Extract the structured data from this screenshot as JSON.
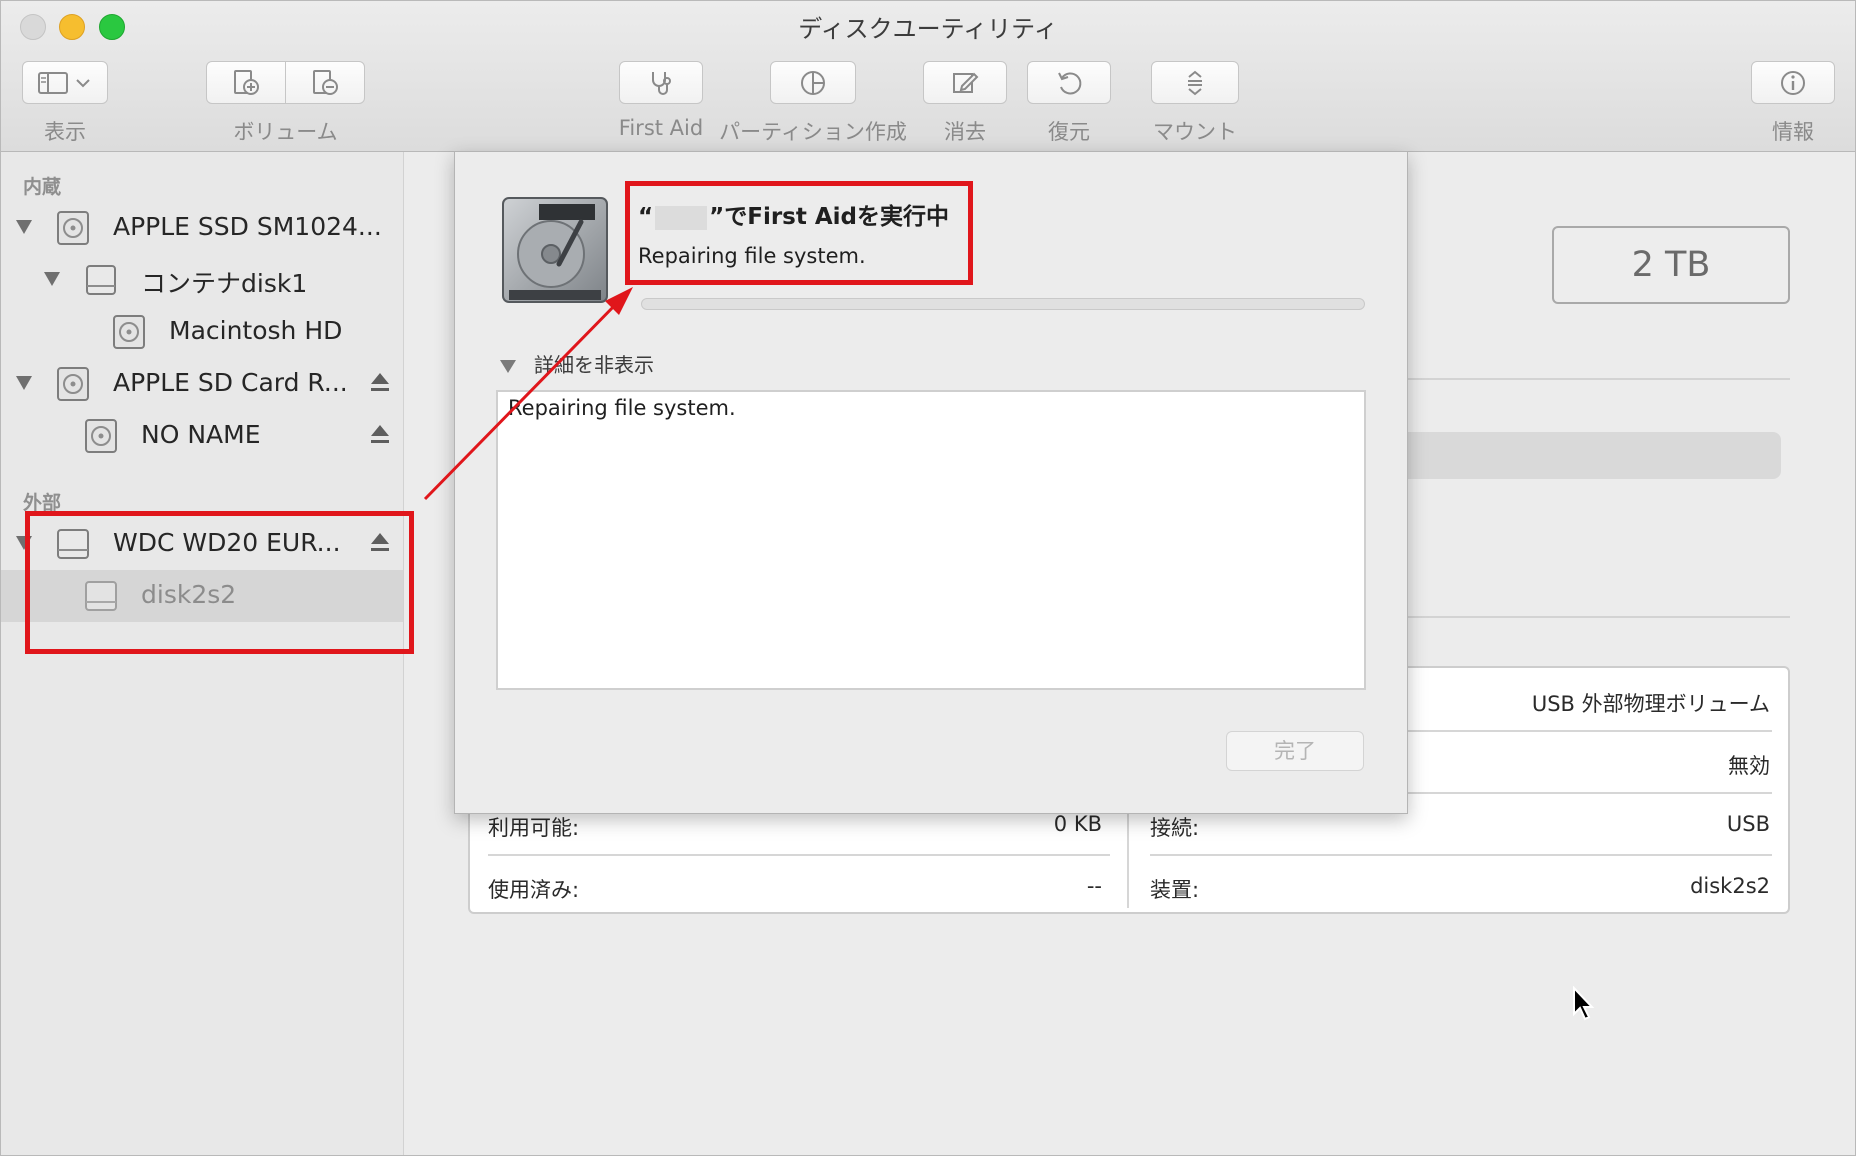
{
  "window": {
    "title": "ディスクユーティリティ"
  },
  "toolbar": {
    "view_label": "表示",
    "volume_label": "ボリューム",
    "first_aid_label": "First Aid",
    "partition_label": "パーティション作成",
    "erase_label": "消去",
    "restore_label": "復元",
    "mount_label": "マウント",
    "info_label": "情報"
  },
  "sidebar": {
    "internal_header": "内蔵",
    "external_header": "外部",
    "items": [
      {
        "label": "APPLE SSD SM1024...",
        "level": 0,
        "icon": "internal-disk-icon"
      },
      {
        "label": "コンテナdisk1",
        "level": 1,
        "icon": "container-icon"
      },
      {
        "label": "Macintosh HD",
        "level": 2,
        "icon": "volume-icon"
      },
      {
        "label": "APPLE SD Card R...",
        "level": 0,
        "icon": "sd-card-icon",
        "ejectable": true
      },
      {
        "label": "NO NAME",
        "level": 1,
        "icon": "volume-icon",
        "ejectable": true
      },
      {
        "label": "WDC WD20 EUR...",
        "level": 0,
        "icon": "external-disk-icon",
        "ejectable": true
      },
      {
        "label": "disk2s2",
        "level": 1,
        "icon": "external-volume-icon",
        "selected": true
      }
    ]
  },
  "main": {
    "capacity": "2 TB",
    "info": {
      "available_label": "利用可能:",
      "available_value": "0 KB",
      "used_label": "使用済み:",
      "used_value": "--",
      "type_value": "USB 外部物理ボリューム",
      "owners_value": "無効",
      "connection_label": "接続:",
      "connection_value": "USB",
      "device_label": "装置:",
      "device_value": "disk2s2"
    }
  },
  "sheet": {
    "title_open_quote": "“",
    "title_suffix": "”でFirst Aidを実行中",
    "status": "Repairing file system.",
    "progress": 0.0,
    "details_toggle": "詳細を非表示",
    "log": "Repairing file system.",
    "done_button": "完了"
  },
  "annotations": {
    "color": "#e0161b"
  }
}
